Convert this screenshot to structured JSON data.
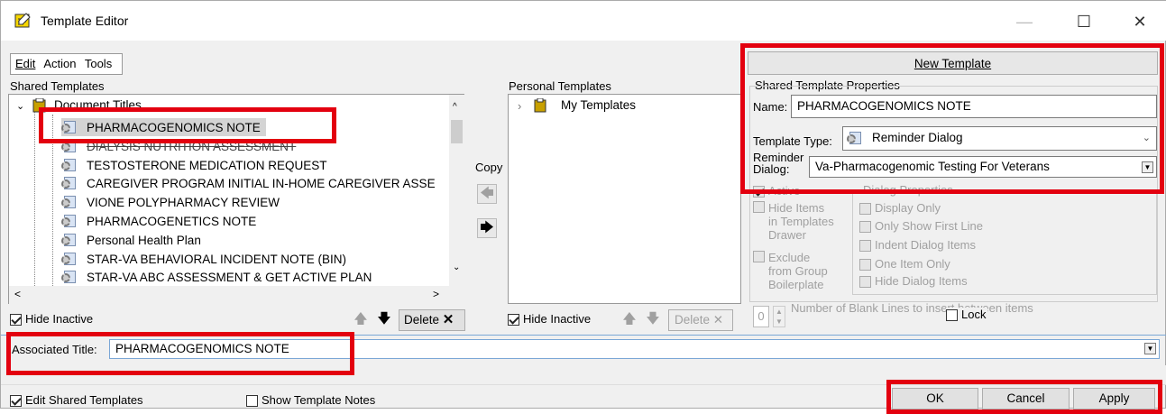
{
  "window": {
    "title": "Template Editor",
    "minimize": "—",
    "maximize": "☐",
    "close": "✕"
  },
  "menu": [
    "Edit",
    "Action",
    "Tools"
  ],
  "shared": {
    "header": "Shared Templates",
    "root": "Document Titles",
    "items": [
      "PHARMACOGENOMICS NOTE",
      "DIALYSIS NUTRITION ASSESSMENT",
      "TESTOSTERONE MEDICATION REQUEST",
      "CAREGIVER PROGRAM INITIAL IN-HOME CAREGIVER ASSE",
      "VIONE POLYPHARMACY REVIEW",
      "PHARMACOGENETICS NOTE",
      "Personal Health Plan",
      "STAR-VA BEHAVIORAL INCIDENT NOTE (BIN)",
      "STAR-VA ABC ASSESSMENT & GET ACTIVE PLAN"
    ],
    "hide_inactive": "Hide Inactive",
    "delete": "Delete"
  },
  "copy": {
    "label": "Copy"
  },
  "personal": {
    "header": "Personal Templates",
    "root": "My Templates",
    "hide_inactive": "Hide Inactive",
    "delete": "Delete"
  },
  "props": {
    "new_template": "New Template",
    "group_title": "Shared Template Properties",
    "name_label": "Name:",
    "name_value": "PHARMACOGENOMICS NOTE",
    "type_label": "Template Type:",
    "type_value": "Reminder Dialog",
    "reminder_label_1": "Reminder",
    "reminder_label_2": "Dialog:",
    "reminder_value": "Va-Pharmacogenomic Testing For Veterans",
    "active": "Active",
    "hide_items_1": "Hide Items",
    "hide_items_2": "in Templates",
    "hide_items_3": "Drawer",
    "exclude_1": "Exclude",
    "exclude_2": "from Group",
    "exclude_3": "Boilerplate",
    "dialog_props_title": "Dialog Properties",
    "display_only": "Display Only",
    "only_first": "Only Show First Line",
    "indent": "Indent Dialog Items",
    "one_item": "One Item Only",
    "hide_dialog": "Hide Dialog Items",
    "blank_lines_value": "0",
    "blank_lines_label": "Number of Blank Lines to insert between items",
    "lock": "Lock"
  },
  "assoc": {
    "label": "Associated Title:",
    "value": "PHARMACOGENOMICS NOTE"
  },
  "footer": {
    "edit_shared": "Edit Shared Templates",
    "show_notes": "Show Template Notes",
    "ok": "OK",
    "cancel": "Cancel",
    "apply": "Apply"
  }
}
